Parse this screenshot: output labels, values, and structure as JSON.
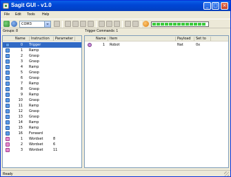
{
  "window": {
    "title": "Sagit GUI - v1.0"
  },
  "menu": [
    "File",
    "Edit",
    "Tools",
    "Help"
  ],
  "toolbar": {
    "combo_value": "COM3",
    "progress_segments": 13,
    "progress_fraction": 1.0
  },
  "left_panel": {
    "label": "Groups: 8",
    "headers": [
      "Name",
      "Instruction",
      "Parameter"
    ],
    "rows": [
      {
        "num": "0",
        "name": "Trigger",
        "param": "",
        "icon": "blue",
        "selected": true
      },
      {
        "num": "1",
        "name": "Ramp",
        "param": "",
        "icon": "blue"
      },
      {
        "num": "2",
        "name": "Grasp",
        "param": "",
        "icon": "blue"
      },
      {
        "num": "3",
        "name": "Grasp",
        "param": "",
        "icon": "blue"
      },
      {
        "num": "4",
        "name": "Ramp",
        "param": "",
        "icon": "blue"
      },
      {
        "num": "5",
        "name": "Grasp",
        "param": "",
        "icon": "blue"
      },
      {
        "num": "6",
        "name": "Grasp",
        "param": "",
        "icon": "blue"
      },
      {
        "num": "7",
        "name": "Ramp",
        "param": "",
        "icon": "blue"
      },
      {
        "num": "8",
        "name": "Grasp",
        "param": "",
        "icon": "blue"
      },
      {
        "num": "9",
        "name": "Ramp",
        "param": "",
        "icon": "blue"
      },
      {
        "num": "10",
        "name": "Grasp",
        "param": "",
        "icon": "blue"
      },
      {
        "num": "11",
        "name": "Ramp",
        "param": "",
        "icon": "blue"
      },
      {
        "num": "12",
        "name": "Grasp",
        "param": "",
        "icon": "blue"
      },
      {
        "num": "13",
        "name": "Grasp",
        "param": "",
        "icon": "blue"
      },
      {
        "num": "14",
        "name": "Ramp",
        "param": "",
        "icon": "blue"
      },
      {
        "num": "15",
        "name": "Ramp",
        "param": "",
        "icon": "blue"
      },
      {
        "num": "16",
        "name": "Forward",
        "param": "",
        "icon": "blue"
      },
      {
        "num": "1",
        "name": "Wordset",
        "param": "8",
        "icon": "pink"
      },
      {
        "num": "2",
        "name": "Wordset",
        "param": "6",
        "icon": "pink"
      },
      {
        "num": "3",
        "name": "Wordset",
        "param": "11",
        "icon": "pink"
      }
    ]
  },
  "right_panel": {
    "label": "Trigger Commands: 1",
    "headers": [
      "Name",
      "Item",
      "Payload",
      "Set to"
    ],
    "rows": [
      {
        "num": "1",
        "item": "Robot",
        "payload": "Nat",
        "setto": "0x"
      }
    ]
  },
  "status": "Ready"
}
